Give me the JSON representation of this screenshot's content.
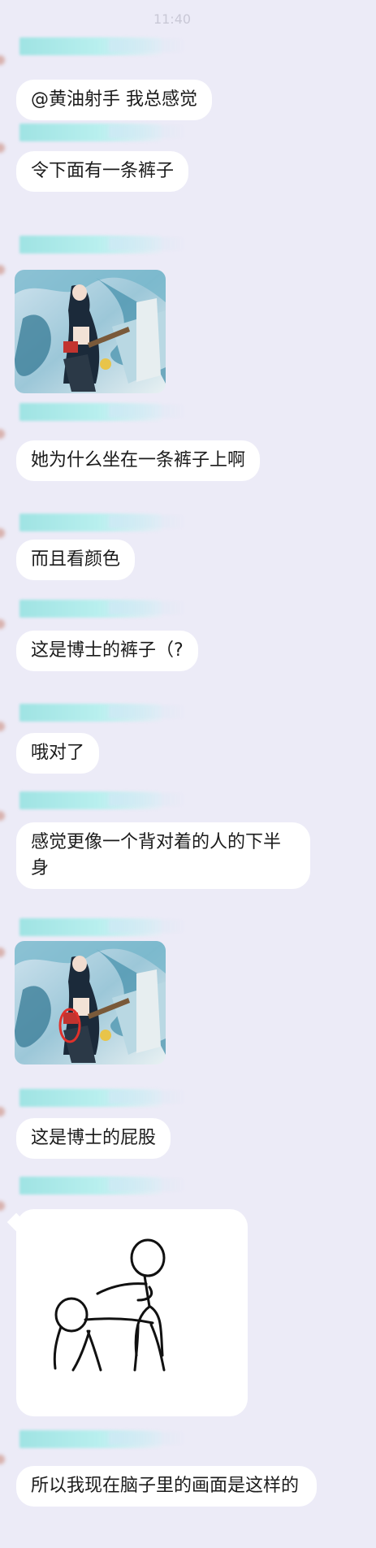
{
  "status": {
    "time": "11:40"
  },
  "messages": [
    {
      "type": "text",
      "text": "@黄油射手  我总感觉"
    },
    {
      "type": "text",
      "text": "令下面有一条裤子"
    },
    {
      "type": "image",
      "image_name": "anime-illustration-thumbnail",
      "annotated": false
    },
    {
      "type": "text",
      "text": "她为什么坐在一条裤子上啊"
    },
    {
      "type": "text",
      "text": "而且看颜色"
    },
    {
      "type": "text",
      "text": "这是博士的裤子（?"
    },
    {
      "type": "text",
      "text": "哦对了"
    },
    {
      "type": "text",
      "text": "感觉更像一个背对着的人的下半身"
    },
    {
      "type": "image",
      "image_name": "anime-illustration-thumbnail-circled",
      "annotated": true
    },
    {
      "type": "text",
      "text": "这是博士的屁股"
    },
    {
      "type": "image",
      "image_name": "stick-figure-drawing"
    },
    {
      "type": "text",
      "text": "所以我现在脑子里的画面是这样的"
    }
  ],
  "colors": {
    "background": "#ecebf7",
    "bubble": "#ffffff",
    "sender_name_blur": "#9fe3e3",
    "annotation_circle": "#e0312b"
  }
}
